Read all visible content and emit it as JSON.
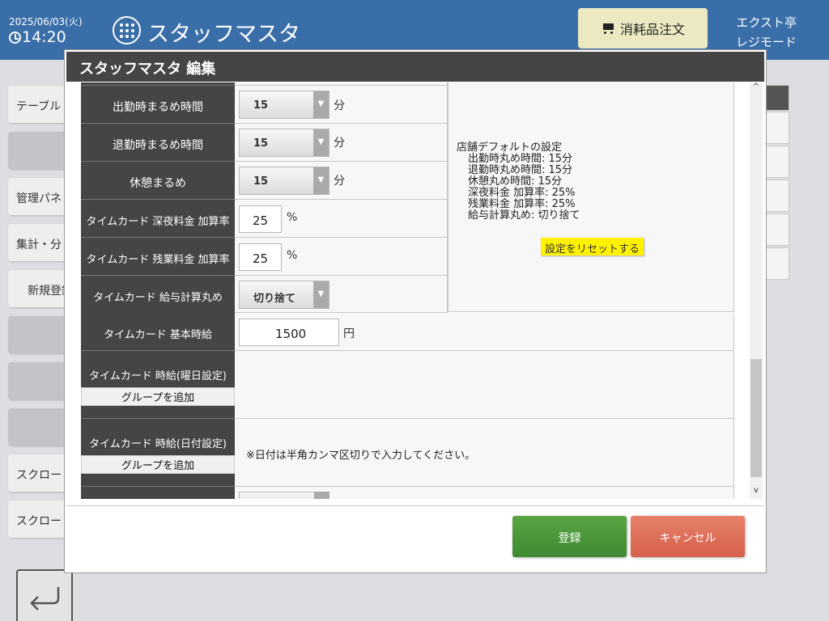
{
  "header": {
    "date": "2025/06/03(火)",
    "time": "14:20",
    "title": "スタッフマスタ",
    "order_button": "消耗品注文",
    "store_name": "エクスト亭",
    "mode": "レジモード",
    "colors": {
      "bar": "#3a6ea8",
      "order_button": "#ece9c2"
    }
  },
  "background": {
    "side_buttons": [
      "テーブル",
      "",
      "管理パネ",
      "集計・分",
      "新規登録",
      "",
      "",
      "",
      "スクロー",
      "スクロー"
    ]
  },
  "modal": {
    "title": "スタッフマスタ 編集",
    "rows": {
      "arrive_round": {
        "label": "出勤時まるめ時間",
        "value": "15",
        "unit": "分"
      },
      "leave_round": {
        "label": "退勤時まるめ時間",
        "value": "15",
        "unit": "分"
      },
      "break_round": {
        "label": "休憩まるめ",
        "value": "15",
        "unit": "分"
      },
      "night_rate": {
        "label": "タイムカード 深夜料金 加算率",
        "value": "25",
        "unit": "%"
      },
      "overtime_rate": {
        "label": "タイムカード 残業料金 加算率",
        "value": "25",
        "unit": "%"
      },
      "pay_round": {
        "label": "タイムカード 給与計算丸め",
        "value": "切り捨て"
      },
      "base_wage": {
        "label": "タイムカード 基本時給",
        "value": "1500",
        "unit": "円"
      },
      "weekday_wage": {
        "label": "タイムカード 時給(曜日設定)",
        "button": "グループを追加"
      },
      "date_wage": {
        "label": "タイムカード 時給(日付設定)",
        "button": "グループを追加",
        "note": "※日付は半角カンマ区切りで入力してください。"
      }
    },
    "defaults": {
      "heading": "店舗デフォルトの設定",
      "lines": [
        "出勤時丸め時間: 15分",
        "退勤時丸め時間: 15分",
        "休憩丸め時間: 15分",
        "深夜料金 加算率: 25%",
        "残業料金 加算率: 25%",
        "給与計算丸め: 切り捨て"
      ],
      "reset_button": "設定をリセットする"
    },
    "buttons": {
      "register": "登録",
      "cancel": "キャンセル"
    },
    "colors": {
      "label_bg": "#454545",
      "register": "#4a9a38",
      "cancel": "#de6f5a",
      "reset": "#fff200"
    }
  }
}
